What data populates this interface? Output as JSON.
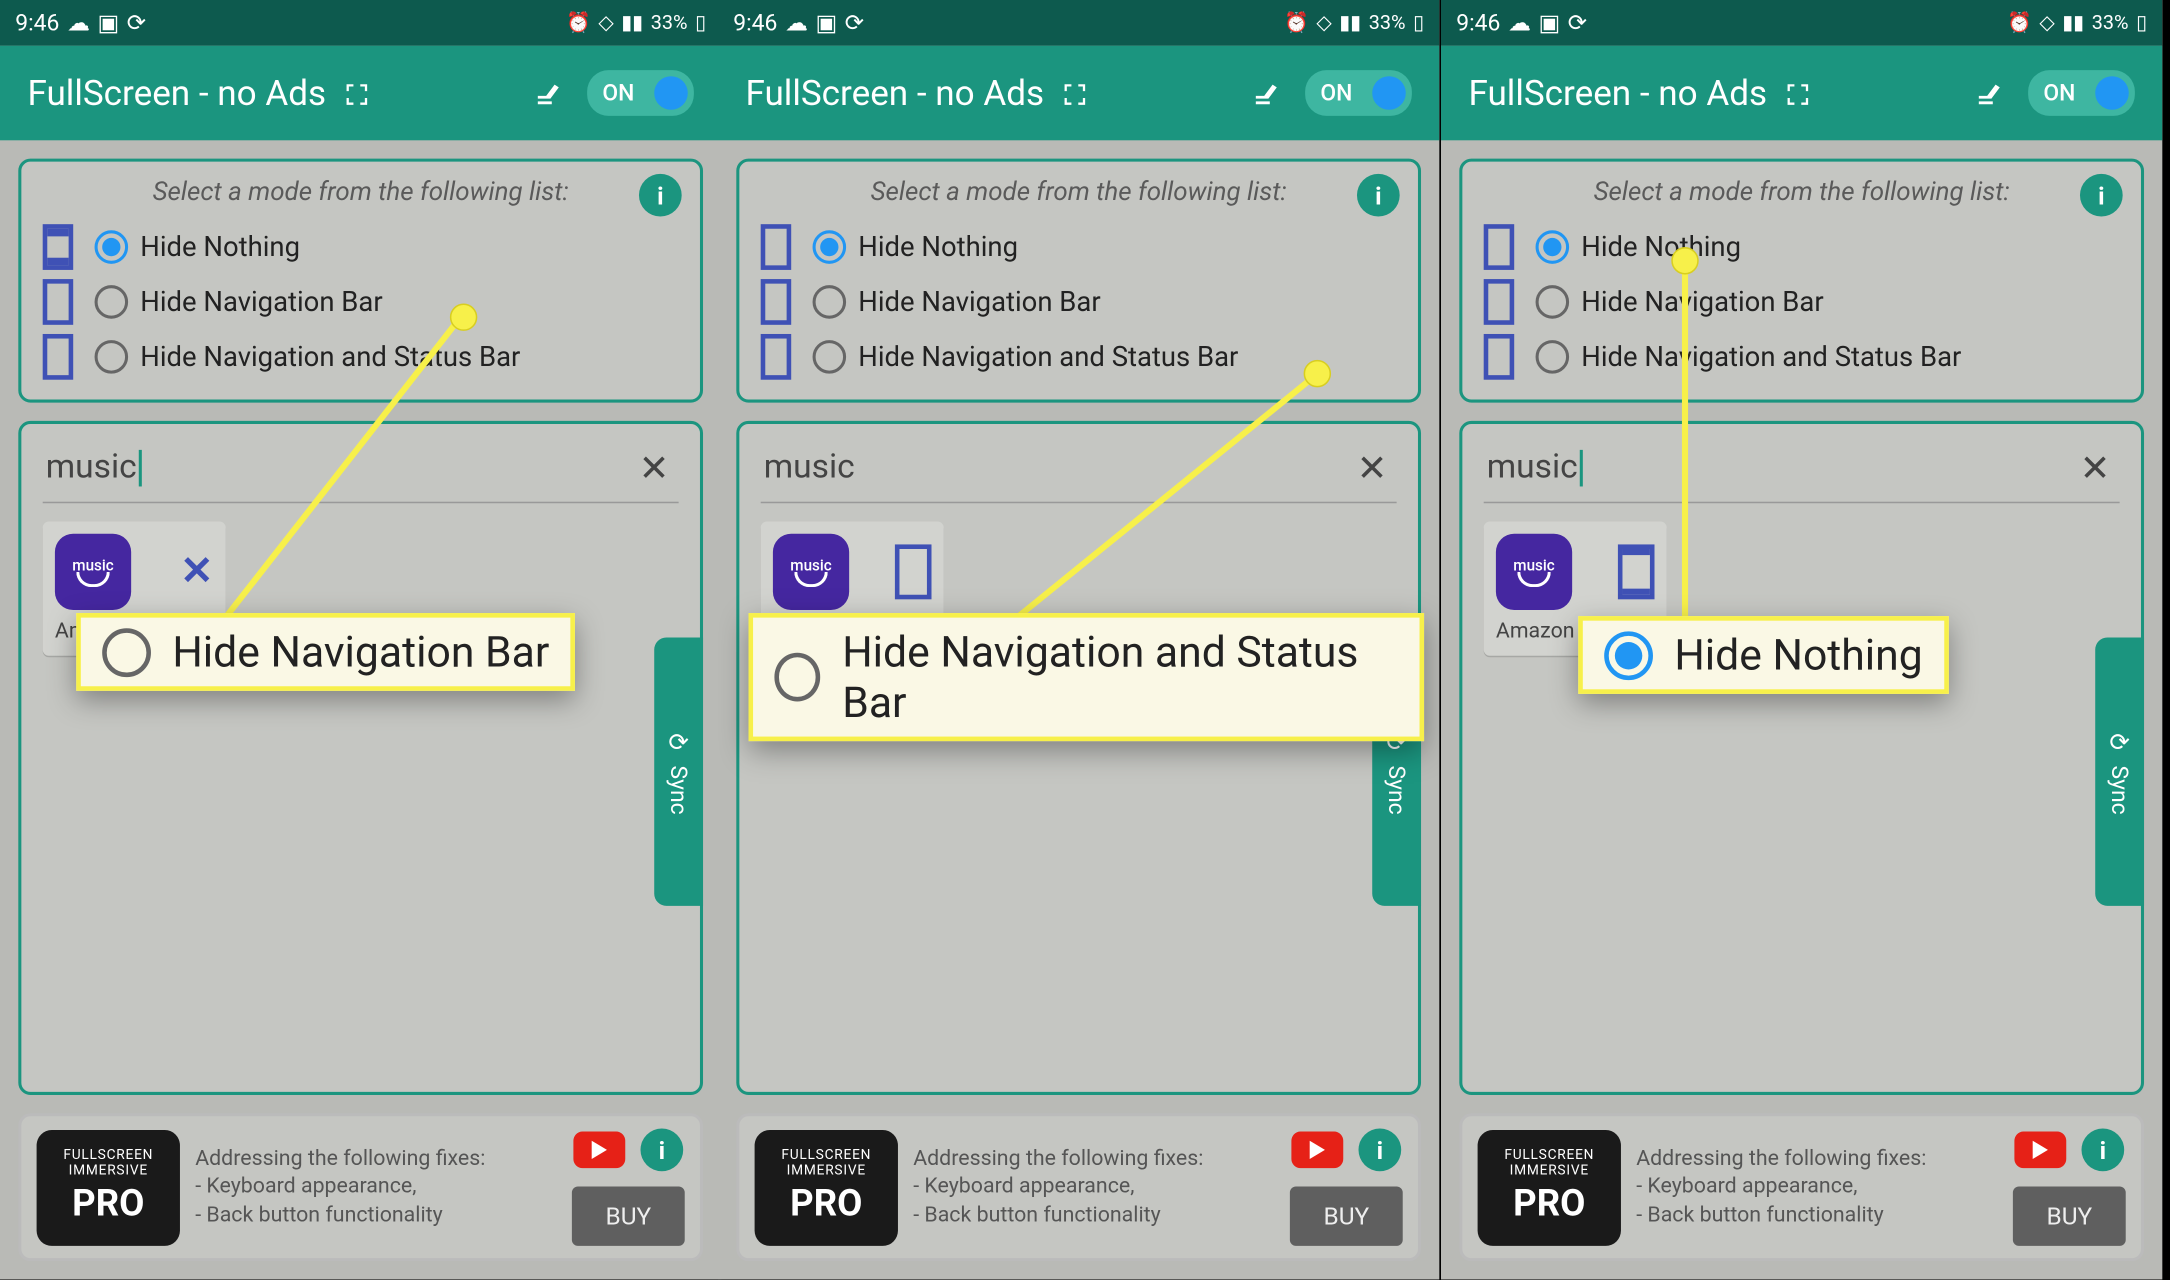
{
  "status": {
    "time": "9:46",
    "battery_pct": "33%"
  },
  "appbar": {
    "title": "FullScreen - no Ads",
    "toggle_label": "ON"
  },
  "mode_card": {
    "title": "Select a mode from the following list:",
    "options": [
      {
        "label": "Hide Nothing"
      },
      {
        "label": "Hide Navigation Bar"
      },
      {
        "label": "Hide Navigation and Status Bar"
      }
    ]
  },
  "search": {
    "value": "music"
  },
  "app_tile": {
    "icon_text": "music",
    "label_full": "Amazon Music",
    "label_short": "Amazon Mu…",
    "label_trunc": "Am"
  },
  "sync": {
    "label": "Sync"
  },
  "bottom": {
    "pro_top": "FULLSCREEN IMMERSIVE",
    "pro_main": "PRO",
    "fixes_heading": "Addressing the following fixes:",
    "fix1": "- Keyboard appearance,",
    "fix2": "- Back button functionality",
    "buy": "BUY"
  },
  "callouts": {
    "one": "Hide Navigation Bar",
    "two": "Hide Navigation and Status Bar",
    "three": "Hide Nothing"
  }
}
